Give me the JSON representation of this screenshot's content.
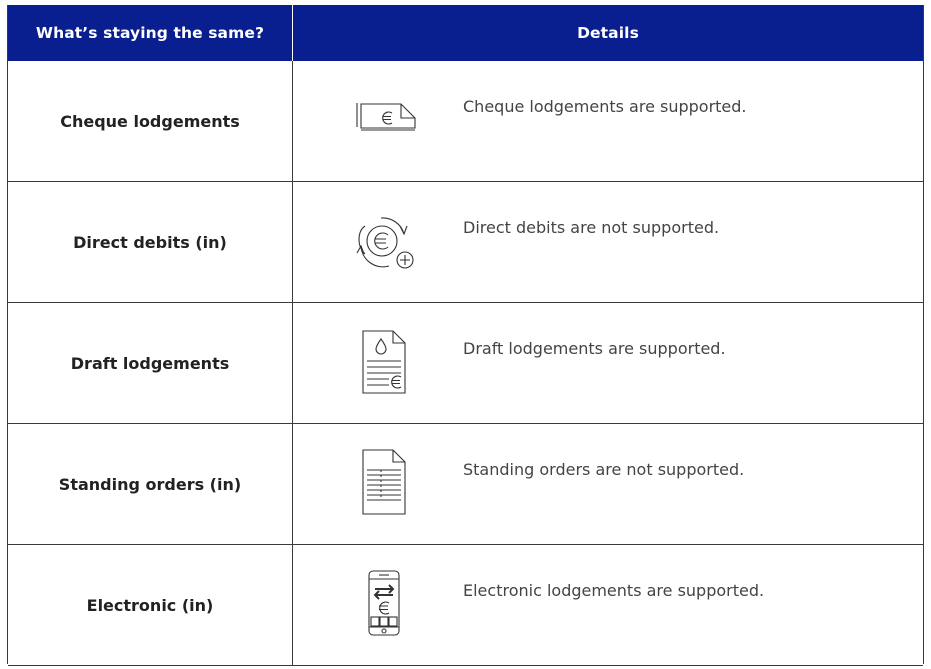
{
  "header": {
    "col1": "What’s staying the same?",
    "col2": "Details",
    "background": "#0a1f8f"
  },
  "rows": [
    {
      "label": "Cheque lodgements",
      "detail": "Cheque lodgements are supported.",
      "icon": "cheque-euro-icon"
    },
    {
      "label": "Direct debits (in)",
      "detail": "Direct debits are not supported.",
      "icon": "euro-cycle-plus-icon"
    },
    {
      "label": "Draft lodgements",
      "detail": "Draft lodgements are supported.",
      "icon": "document-drop-euro-icon"
    },
    {
      "label": "Standing orders (in)",
      "detail": "Standing orders are not supported.",
      "icon": "document-lines-icon"
    },
    {
      "label": "Electronic (in)",
      "detail": "Electronic lodgements are supported.",
      "icon": "mobile-transfer-euro-icon"
    }
  ]
}
